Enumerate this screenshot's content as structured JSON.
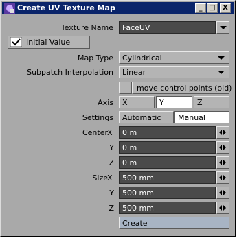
{
  "window": {
    "title": "Create UV Texture Map",
    "minimize_label": "_",
    "maximize_label": "□",
    "close_label": "X"
  },
  "texture_name": {
    "label": "Texture Name",
    "value": "FaceUV"
  },
  "initial_value": {
    "label": "Initial Value",
    "checked": true
  },
  "map_type": {
    "label": "Map Type",
    "value": "Cylindrical"
  },
  "subpatch_interpolation": {
    "label": "Subpatch Interpolation",
    "value": "Linear"
  },
  "move_control_points": {
    "label": "move control points (old)"
  },
  "axis": {
    "label": "Axis",
    "options": [
      "X",
      "Y",
      "Z"
    ],
    "selected": "Y"
  },
  "settings": {
    "label": "Settings",
    "options": [
      "Automatic",
      "Manual"
    ],
    "selected": "Manual"
  },
  "center": {
    "label": "Center",
    "x": {
      "label": "X",
      "value": "0 m"
    },
    "y": {
      "label": "Y",
      "value": "0 m"
    },
    "z": {
      "label": "Z",
      "value": "0 m"
    }
  },
  "size": {
    "label": "Size",
    "x": {
      "label": "X",
      "value": "500 mm"
    },
    "y": {
      "label": "Y",
      "value": "500 mm"
    },
    "z": {
      "label": "Z",
      "value": "500 mm"
    }
  },
  "create_button": {
    "label": "Create"
  }
}
